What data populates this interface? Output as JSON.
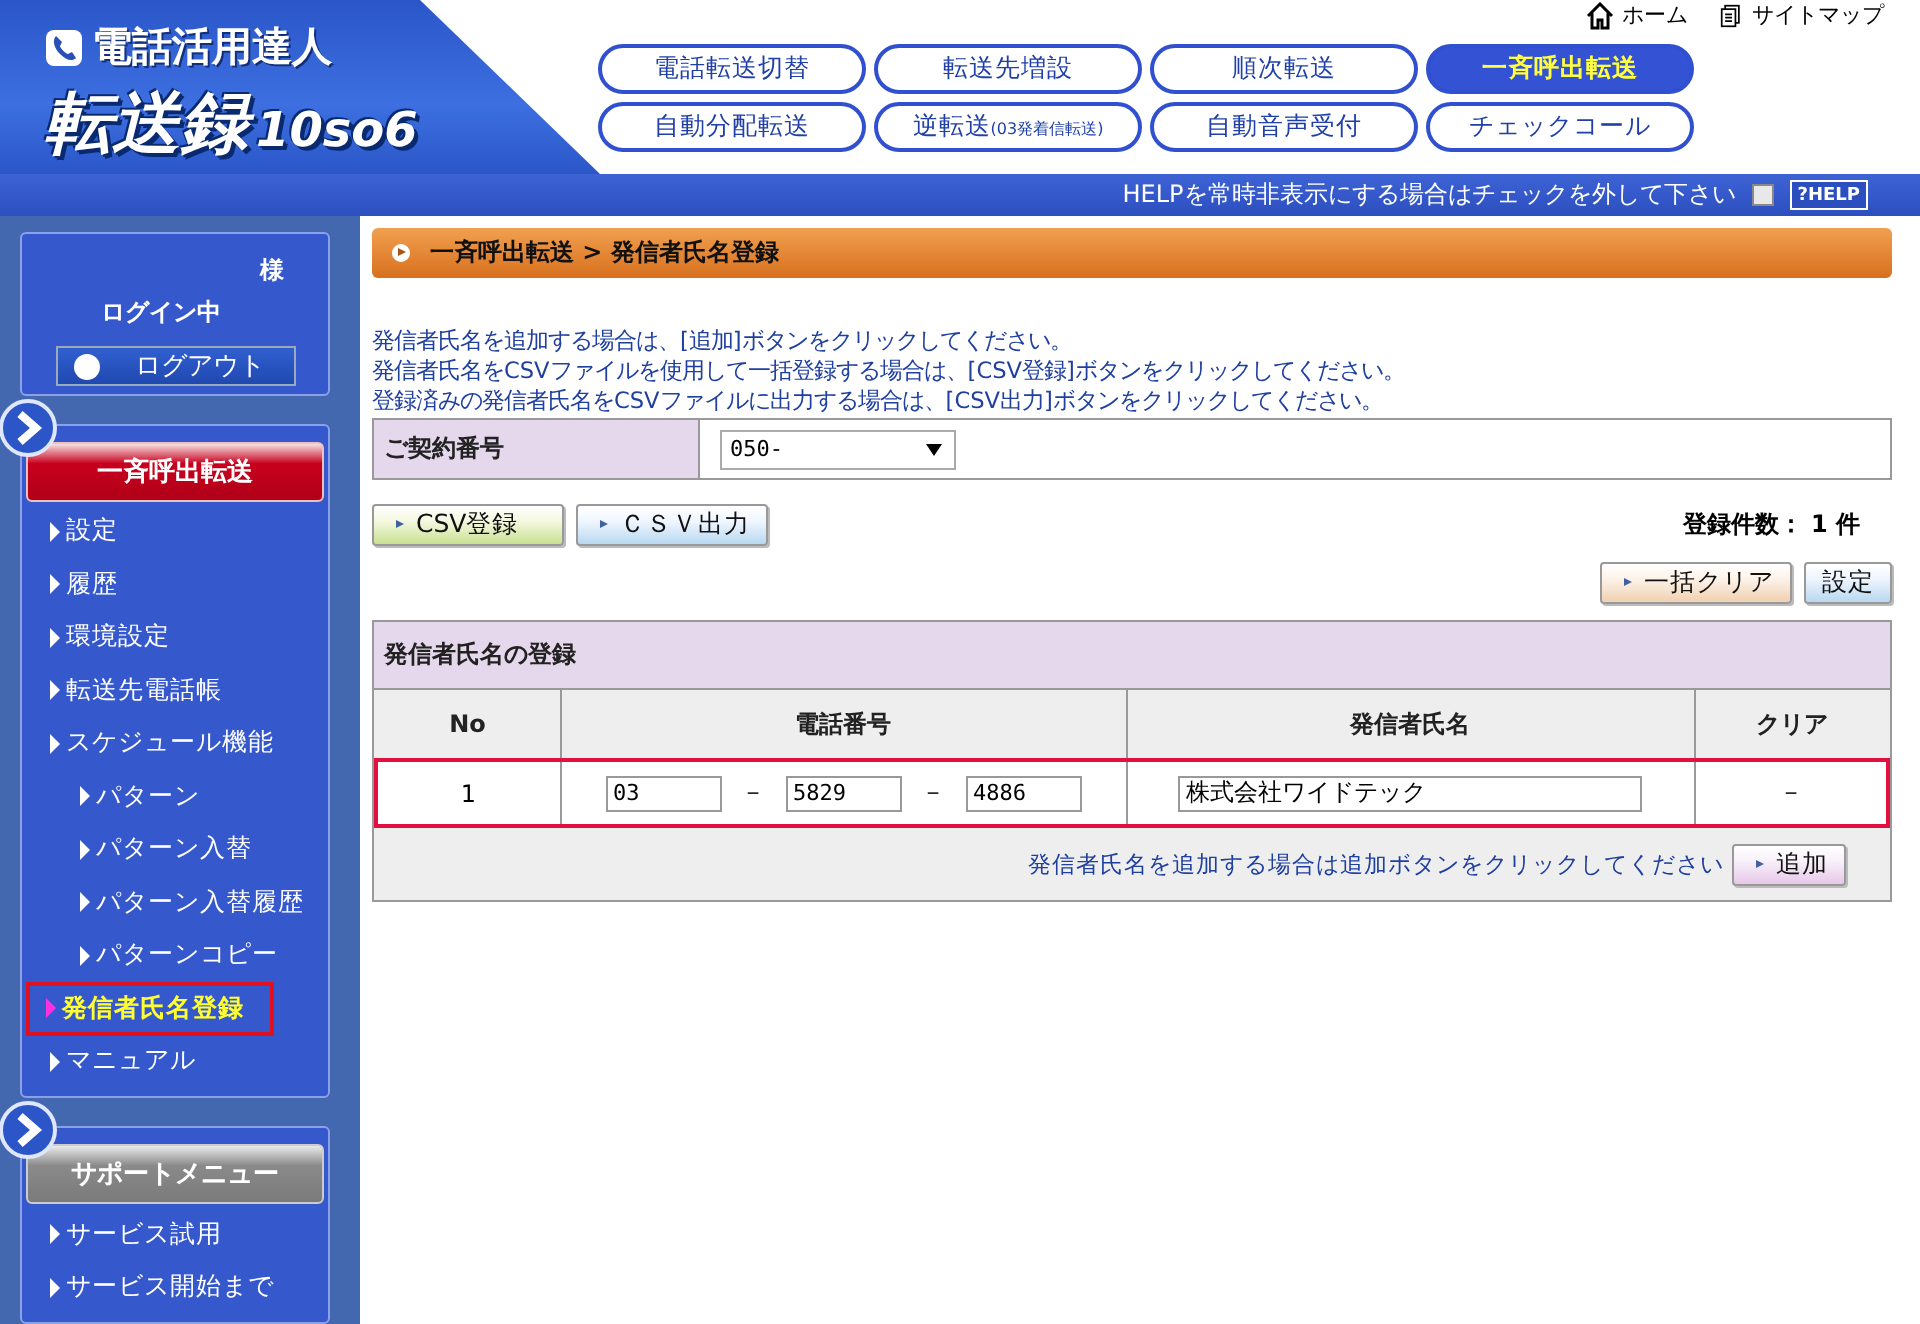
{
  "logo": {
    "subtitle": "電話活用達人",
    "title": "転送録",
    "version": "10so6"
  },
  "top_links": [
    {
      "label": "ホーム",
      "kind": "home"
    },
    {
      "label": "サイトマップ",
      "kind": "sitemap"
    }
  ],
  "nav_tabs": [
    {
      "label": "電話転送切替",
      "selected": false
    },
    {
      "label": "転送先増設",
      "selected": false
    },
    {
      "label": "順次転送",
      "selected": false
    },
    {
      "label": "一斉呼出転送",
      "selected": true
    },
    {
      "label": "自動分配転送",
      "selected": false
    },
    {
      "label": "逆転送",
      "suffix": "(03発着信転送)",
      "selected": false
    },
    {
      "label": "自動音声受付",
      "selected": false
    },
    {
      "label": "チェックコール",
      "selected": false
    }
  ],
  "help_bar": {
    "text": "HELPを常時非表示にする場合はチェックを外して下さい",
    "checked": false,
    "button": "?HELP"
  },
  "user": {
    "honorific": "様",
    "status": "ログイン中",
    "logout": "ログアウト"
  },
  "menus": [
    {
      "title": "一斉呼出転送",
      "active": true,
      "items": [
        {
          "label": "設定",
          "selected": false
        },
        {
          "label": "履歴",
          "selected": false
        },
        {
          "label": "環境設定",
          "selected": false
        },
        {
          "label": "転送先電話帳",
          "selected": false
        },
        {
          "label": "スケジュール機能",
          "selected": false,
          "children": [
            {
              "label": "パターン",
              "selected": false
            },
            {
              "label": "パターン入替",
              "selected": false
            },
            {
              "label": "パターン入替履歴",
              "selected": false
            },
            {
              "label": "パターンコピー",
              "selected": false
            }
          ]
        },
        {
          "label": "発信者氏名登録",
          "selected": true
        },
        {
          "label": "マニュアル",
          "selected": false
        }
      ]
    },
    {
      "title": "サポートメニュー",
      "active": false,
      "items": [
        {
          "label": "サービス試用",
          "selected": false
        },
        {
          "label": "サービス開始まで",
          "selected": false
        }
      ]
    }
  ],
  "breadcrumb": "一斉呼出転送 > 発信者氏名登録",
  "instructions": [
    "発信者氏名を追加する場合は、[追加]ボタンをクリックしてください。",
    "発信者氏名をCSVファイルを使用して一括登録する場合は、[CSV登録]ボタンをクリックしてください。",
    "登録済みの発信者氏名をCSVファイルに出力する場合は、[CSV出力]ボタンをクリックしてください。"
  ],
  "contract": {
    "label": "ご契約番号",
    "value": "050-"
  },
  "csv_buttons": [
    {
      "label": "CSV登録",
      "kind": "import"
    },
    {
      "label": "ＣＳＶ出力",
      "kind": "export"
    }
  ],
  "count": "登録件数： 1 件",
  "actions": [
    {
      "label": "一括クリア",
      "kind": "clear"
    },
    {
      "label": "設定",
      "kind": "save"
    }
  ],
  "register": {
    "title": "発信者氏名の登録",
    "columns": [
      "No",
      "電話番号",
      "発信者氏名",
      "クリア"
    ],
    "rows": [
      {
        "no": "1",
        "phone": [
          "03",
          "5829",
          "4886"
        ],
        "separators": [
          "－",
          "－"
        ],
        "name": "株式会社ワイドテック",
        "clear": "－",
        "selected": true
      }
    ],
    "hint": "発信者氏名を追加する場合は追加ボタンをクリックしてください",
    "add_button": "追加"
  }
}
